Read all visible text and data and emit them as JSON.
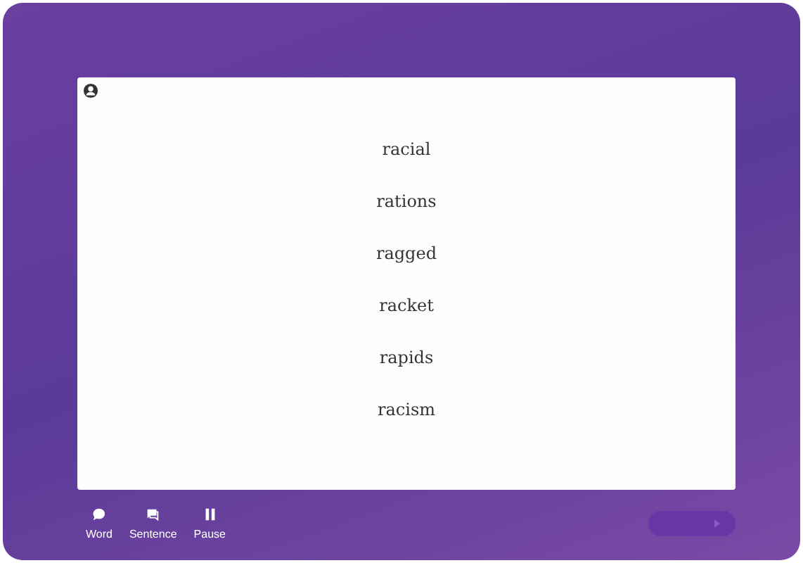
{
  "words": [
    "racial",
    "rations",
    "ragged",
    "racket",
    "rapids",
    "racism"
  ],
  "toolbar": [
    {
      "kind": "word",
      "label": "Word"
    },
    {
      "kind": "sentence",
      "label": "Sentence"
    },
    {
      "kind": "pause",
      "label": "Pause"
    }
  ],
  "next_button": {
    "disabled": true
  }
}
